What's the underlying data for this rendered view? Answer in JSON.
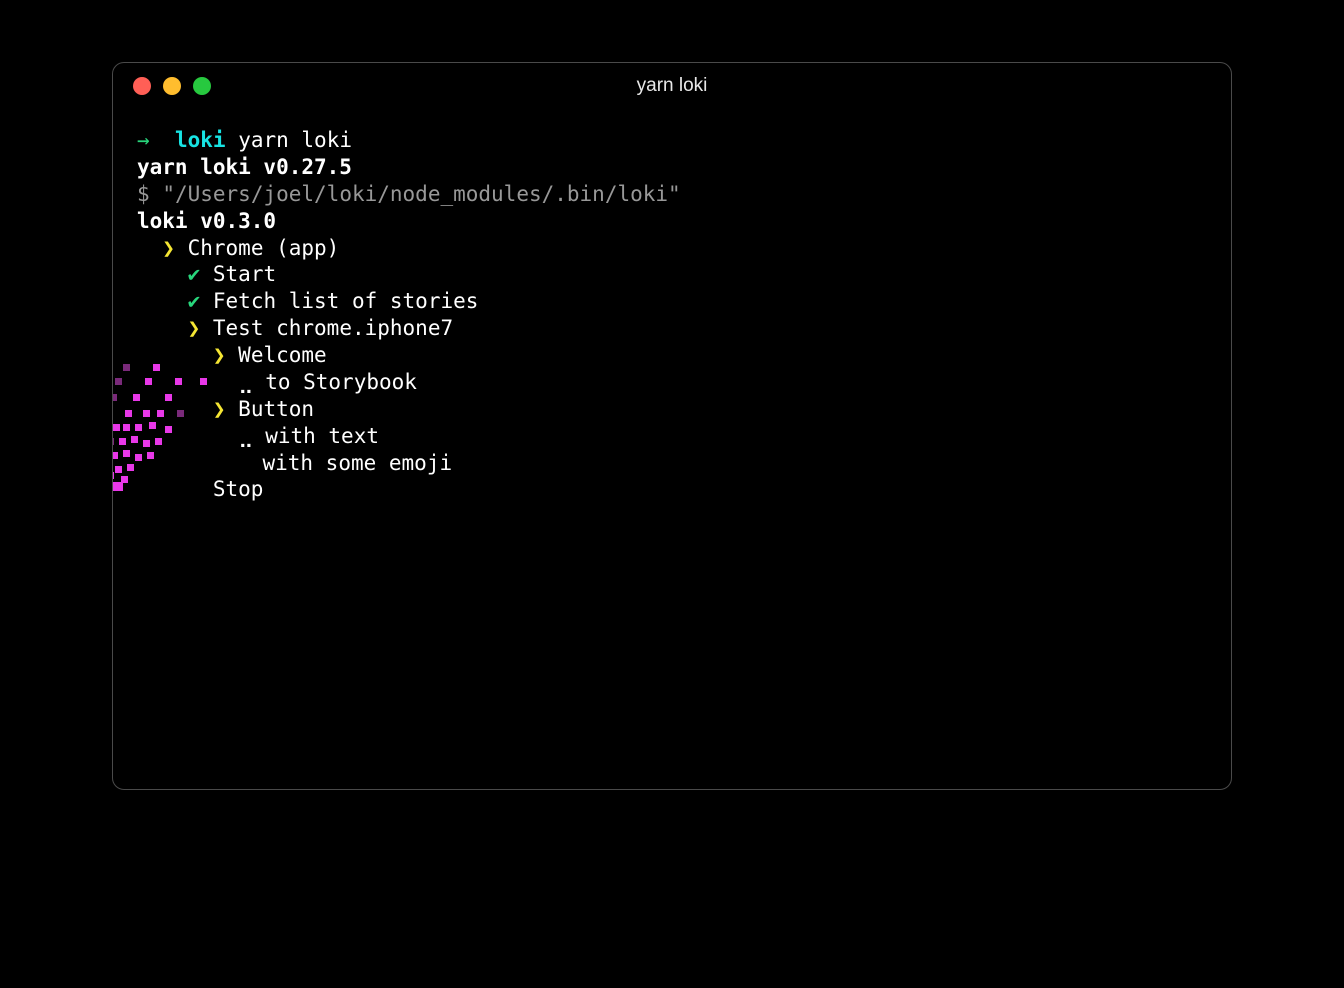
{
  "window": {
    "title": "yarn loki"
  },
  "prompt": {
    "arrow": "→",
    "project": "loki",
    "command": "yarn loki"
  },
  "lines": {
    "yarn_version": "yarn loki v0.27.5",
    "exec_prefix": "$",
    "exec_path": "\"/Users/joel/loki/node_modules/.bin/loki\"",
    "loki_version": "loki v0.3.0"
  },
  "tree": {
    "target_marker": "❯",
    "target_label": "Chrome (app)",
    "steps": [
      {
        "marker": "✔",
        "label": "Start",
        "cls": "green-check"
      },
      {
        "marker": "✔",
        "label": "Fetch list of stories",
        "cls": "green-check"
      },
      {
        "marker": "❯",
        "label": "Test chrome.iphone7",
        "cls": "yellow"
      }
    ],
    "stories": [
      {
        "group_marker": "❯",
        "group_label": "Welcome",
        "items": [
          {
            "marker": "⣀",
            "label": "to Storybook"
          }
        ]
      },
      {
        "group_marker": "❯",
        "group_label": "Button",
        "items": [
          {
            "marker": "⣀",
            "label": "with text"
          },
          {
            "marker": " ",
            "label": "with some emoji"
          }
        ]
      }
    ],
    "stop_label": "Stop"
  }
}
